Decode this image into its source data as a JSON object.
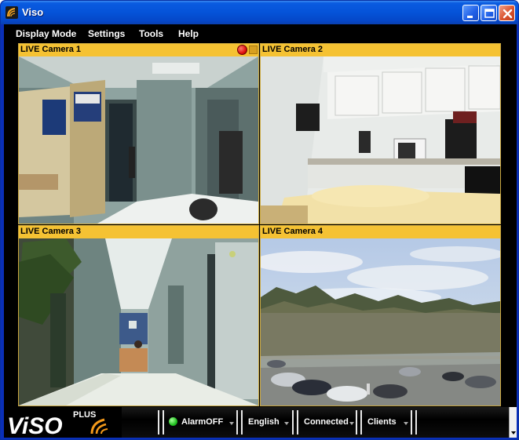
{
  "window": {
    "title": "Viso",
    "icon": "viso-swirl-icon",
    "controls": [
      "minimize-icon",
      "maximize-icon",
      "close-icon"
    ]
  },
  "menu": {
    "items": [
      {
        "label": "Display Mode"
      },
      {
        "label": "Settings"
      },
      {
        "label": "Tools"
      },
      {
        "label": "Help"
      }
    ]
  },
  "cameras": [
    {
      "label": "LIVE Camera 1",
      "recording": true,
      "scene": "office-doorway"
    },
    {
      "label": "LIVE Camera 2",
      "recording": false,
      "scene": "kitchen"
    },
    {
      "label": "LIVE Camera 3",
      "recording": false,
      "scene": "hallway"
    },
    {
      "label": "LIVE Camera 4",
      "recording": false,
      "scene": "parking-lot"
    }
  ],
  "statusbar": {
    "logo_main": "ViSO",
    "logo_badge": "PLUS",
    "alarm": "AlarmOFF",
    "language": "English",
    "connection": "Connected",
    "clients": "Clients"
  },
  "colors": {
    "camera_header": "#f5c233",
    "titlebar": "#0553d8",
    "alarm_led": "#1fc01f",
    "record_dot": "#e01010",
    "logo_orange": "#f59a1a"
  }
}
